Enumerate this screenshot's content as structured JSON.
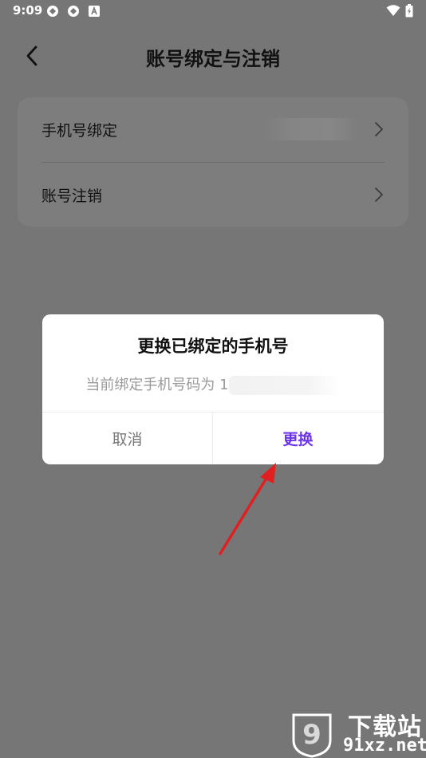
{
  "status_bar": {
    "time": "9:09",
    "icons": [
      "app-notification-icon",
      "app-notification-icon",
      "a-icon",
      "wifi-icon",
      "battery-icon"
    ]
  },
  "header": {
    "title": "账号绑定与注销",
    "back_icon": "chevron-left-icon"
  },
  "settings": {
    "items": [
      {
        "label": "手机号绑定",
        "value_obscured": true,
        "icon": "chevron-right-icon"
      },
      {
        "label": "账号注销",
        "icon": "chevron-right-icon"
      }
    ]
  },
  "dialog": {
    "title": "更换已绑定的手机号",
    "message_prefix": "当前绑定手机号码为 1",
    "cancel_label": "取消",
    "confirm_label": "更换"
  },
  "colors": {
    "overlay_background": "#767676",
    "accent": "#6b32e8",
    "annotation_arrow": "#e02020"
  },
  "watermark": {
    "badge_text": "9",
    "title": "下载站",
    "domain": "91xz.net"
  }
}
